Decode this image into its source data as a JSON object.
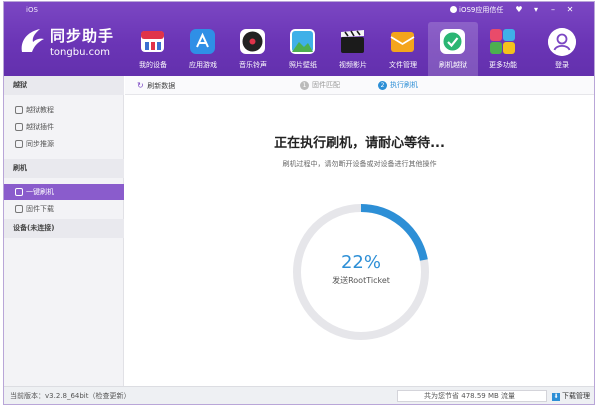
{
  "titlebar": {
    "os_label": "iOS",
    "trust_label": "iOS9应用信任",
    "window_buttons": [
      "♥",
      "▾",
      "–",
      "✕"
    ]
  },
  "logo": {
    "name_cn": "同步助手",
    "name_en": "tongbu.com"
  },
  "nav": {
    "items": [
      {
        "label": "我的设备",
        "icon": "my-device-icon",
        "color": "#e0334a"
      },
      {
        "label": "应用游戏",
        "icon": "apps-games-icon",
        "color": "#2f8fe6"
      },
      {
        "label": "音乐铃声",
        "icon": "music-icon",
        "color": "#222222"
      },
      {
        "label": "照片壁纸",
        "icon": "photos-icon",
        "color": "#3fb0e8"
      },
      {
        "label": "视频影片",
        "icon": "video-icon",
        "color": "#1b1b1b"
      },
      {
        "label": "文件管理",
        "icon": "files-icon",
        "color": "#f4a51c"
      },
      {
        "label": "刷机越狱",
        "icon": "flash-jailbreak-icon",
        "color": "#2bb673"
      },
      {
        "label": "更多功能",
        "icon": "more-icon",
        "color": "#e94b6a"
      }
    ],
    "active_index": 6,
    "login_label": "登录"
  },
  "sidebar": {
    "sections": [
      {
        "title": "越狱",
        "items": [
          "越狱教程",
          "越狱插件",
          "同步推源"
        ]
      },
      {
        "title": "刷机",
        "items": [
          "一键刷机",
          "固件下载"
        ]
      },
      {
        "title": "设备(未连接)",
        "items": []
      }
    ],
    "active_item": "一键刷机"
  },
  "toolbar": {
    "refresh_label": "刷新数据",
    "steps": [
      {
        "num": "1",
        "label": "固件匹配"
      },
      {
        "num": "2",
        "label": "执行刷机"
      }
    ],
    "active_step": 1
  },
  "main": {
    "heading": "正在执行刷机，请耐心等待...",
    "subtext": "刷机过程中，请勿断开设备或对设备进行其他操作",
    "progress": 0.22,
    "progress_label": "22%",
    "status": "发送RootTicket",
    "ring_track_color": "#e6e6ea",
    "ring_fill_color": "#2d8fd6"
  },
  "statusbar": {
    "version": "当前版本：v3.2.8_64bit（检查更新）",
    "saved_label": "共为您节省",
    "saved_value": "478.59 MB",
    "saved_unit": "流量",
    "download_label": "下载管理"
  }
}
